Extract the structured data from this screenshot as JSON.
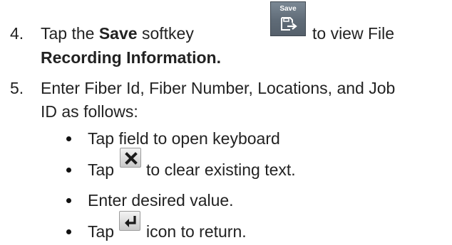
{
  "steps": [
    {
      "number": "4.",
      "line1_pre": "Tap the ",
      "line1_bold": "Save",
      "line1_post": " softkey",
      "line1_after_icon": "to view File",
      "line2_bold": "Recording Information."
    },
    {
      "number": "5.",
      "line1": "Enter Fiber Id, Fiber Number, Locations, and Job",
      "line2": "ID as follows:"
    }
  ],
  "softkey": {
    "label": "Save",
    "icon": "save-disk-arrow-icon"
  },
  "bullets": [
    {
      "text": "Tap field to open keyboard"
    },
    {
      "pre": "Tap",
      "icon": "clear-x-icon",
      "post": "to clear existing text."
    },
    {
      "text": "Enter desired value."
    },
    {
      "pre": "Tap",
      "icon": "enter-return-icon",
      "post": "icon to return."
    }
  ]
}
